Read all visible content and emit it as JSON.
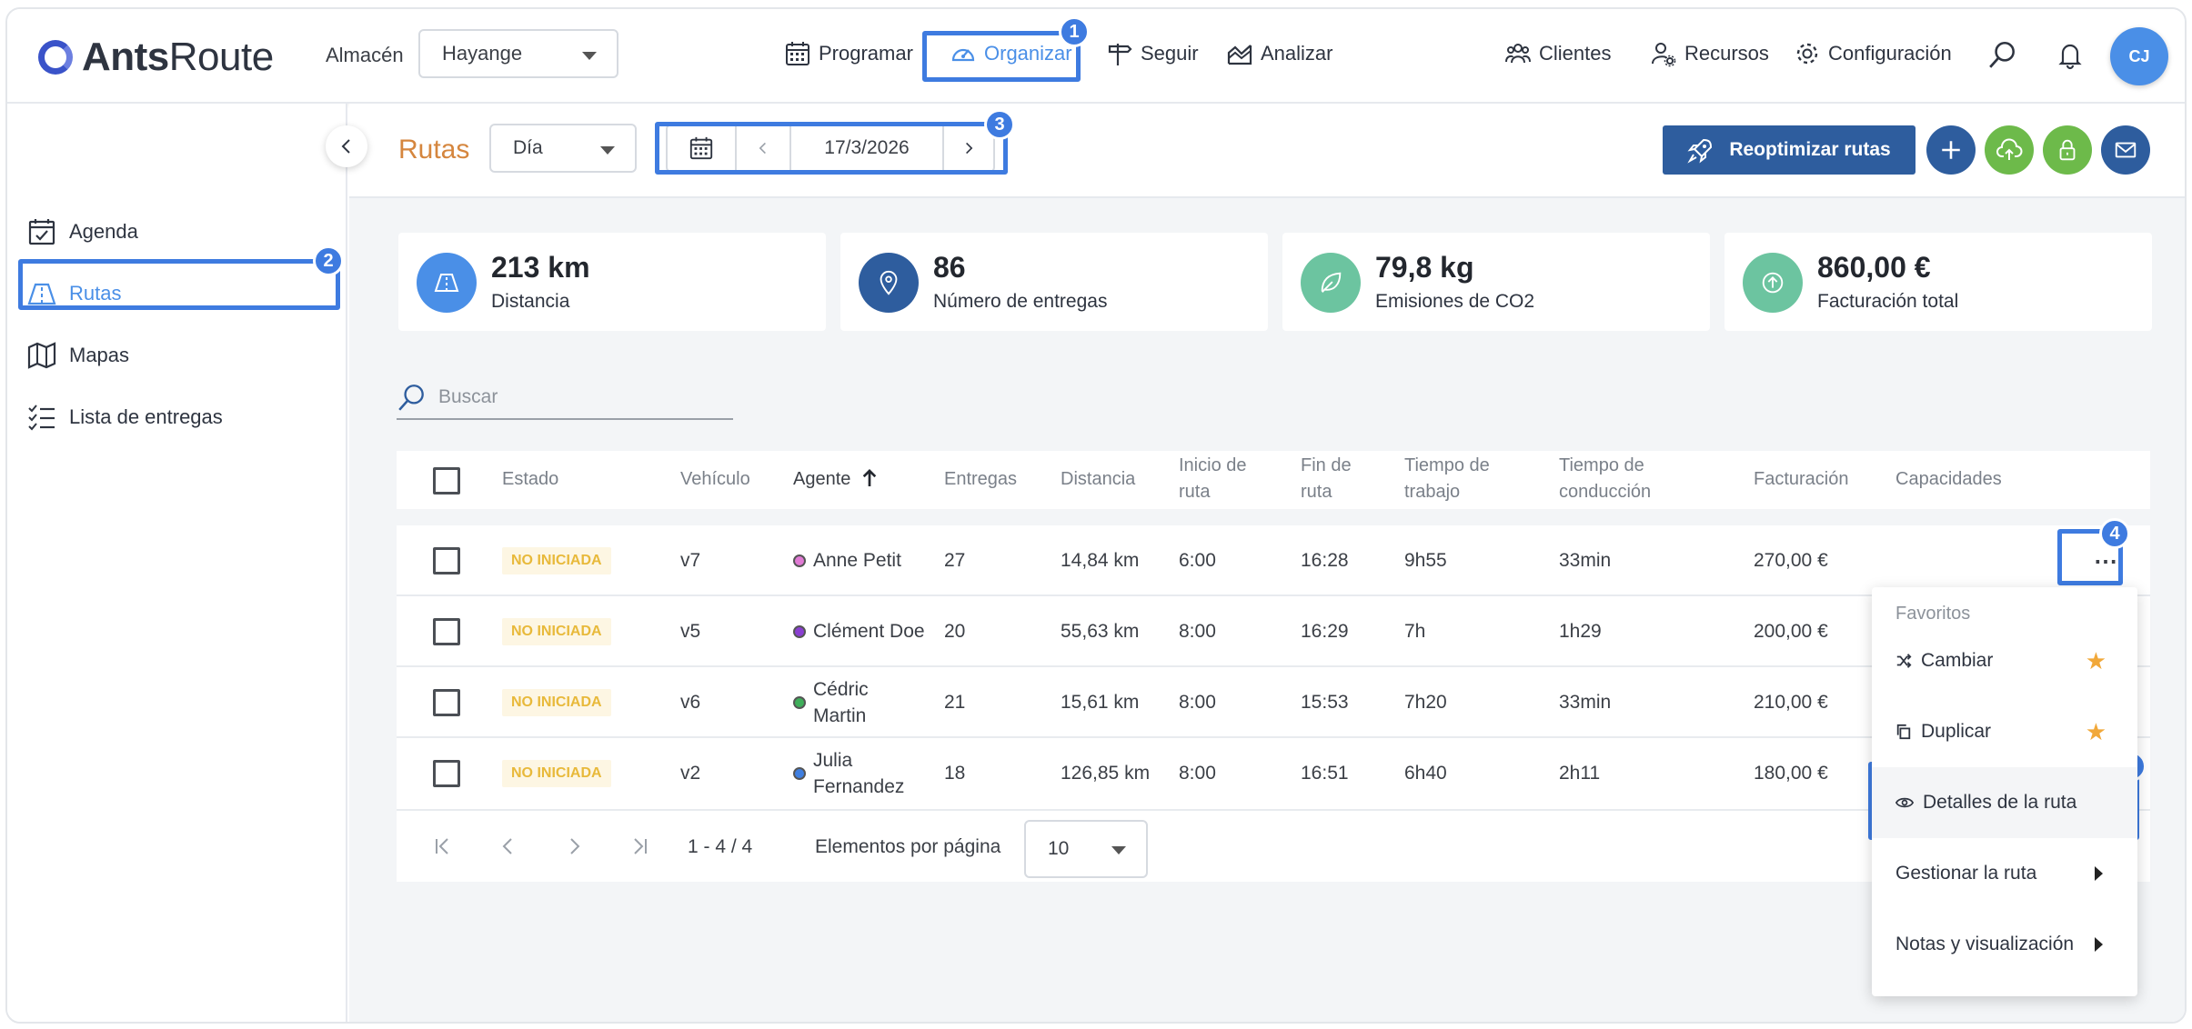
{
  "app": {
    "brand_bold": "Ants",
    "brand_light": "Route"
  },
  "header": {
    "store_label": "Almacén",
    "store_value": "Hayange",
    "nav": [
      "Programar",
      "Organizar",
      "Seguir",
      "Analizar"
    ],
    "right_nav": [
      "Clientes",
      "Recursos",
      "Configuración"
    ],
    "avatar": "CJ"
  },
  "sidebar": {
    "items": [
      "Agenda",
      "Rutas",
      "Mapas",
      "Lista de entregas"
    ]
  },
  "toolbar": {
    "title": "Rutas",
    "period": "Día",
    "date": "17/3/2026",
    "reoptimize": "Reoptimizar rutas"
  },
  "kpis": [
    {
      "value": "213 km",
      "label": "Distancia",
      "color": "#4a8fe7",
      "icon": "road-icon"
    },
    {
      "value": "86",
      "label": "Número de entregas",
      "color": "#2e5d9e",
      "icon": "location-pin-icon"
    },
    {
      "value": "79,8 kg",
      "label": "Emisiones de CO2",
      "color": "#6cc4a0",
      "icon": "leaf-icon"
    },
    {
      "value": "860,00 €",
      "label": "Facturación total",
      "color": "#6cc4a0",
      "icon": "arrow-up-circle-icon"
    }
  ],
  "search": {
    "placeholder": "Buscar"
  },
  "table": {
    "headers": {
      "estado": "Estado",
      "vehiculo": "Vehículo",
      "agente": "Agente",
      "entregas": "Entregas",
      "distancia": "Distancia",
      "inicio_1": "Inicio de",
      "inicio_2": "ruta",
      "fin_1": "Fin de",
      "fin_2": "ruta",
      "trabajo_1": "Tiempo de",
      "trabajo_2": "trabajo",
      "conduccion_1": "Tiempo de",
      "conduccion_2": "conducción",
      "facturacion": "Facturación",
      "capacidades": "Capacidades"
    },
    "rows": [
      {
        "status": "NO INICIADA",
        "vehicle": "v7",
        "agent_1": "Anne Petit",
        "agent_2": "",
        "agent_color": "#e07ad4",
        "deliveries": "27",
        "distance": "14,84 km",
        "start": "6:00",
        "end": "16:28",
        "work": "9h55",
        "drive": "33min",
        "billing": "270,00 €"
      },
      {
        "status": "NO INICIADA",
        "vehicle": "v5",
        "agent_1": "Clément Doe",
        "agent_2": "",
        "agent_color": "#8a3fd1",
        "deliveries": "20",
        "distance": "55,63 km",
        "start": "8:00",
        "end": "16:29",
        "work": "7h",
        "drive": "1h29",
        "billing": "200,00 €"
      },
      {
        "status": "NO INICIADA",
        "vehicle": "v6",
        "agent_1": "Cédric",
        "agent_2": "Martin",
        "agent_color": "#3fae5a",
        "deliveries": "21",
        "distance": "15,61 km",
        "start": "8:00",
        "end": "15:53",
        "work": "7h20",
        "drive": "33min",
        "billing": "210,00 €"
      },
      {
        "status": "NO INICIADA",
        "vehicle": "v2",
        "agent_1": "Julia",
        "agent_2": "Fernandez",
        "agent_color": "#3f7fe0",
        "deliveries": "18",
        "distance": "126,85 km",
        "start": "8:00",
        "end": "16:51",
        "work": "6h40",
        "drive": "2h11",
        "billing": "180,00 €"
      }
    ]
  },
  "pager": {
    "range": "1 - 4 / 4",
    "per_page_label": "Elementos por página",
    "per_page": "10"
  },
  "menu": {
    "section": "Favoritos",
    "items": [
      "Cambiar",
      "Duplicar",
      "Detalles de la ruta",
      "Gestionar la ruta",
      "Notas y visualización"
    ]
  },
  "badges": [
    "1",
    "2",
    "3",
    "4",
    "5"
  ]
}
